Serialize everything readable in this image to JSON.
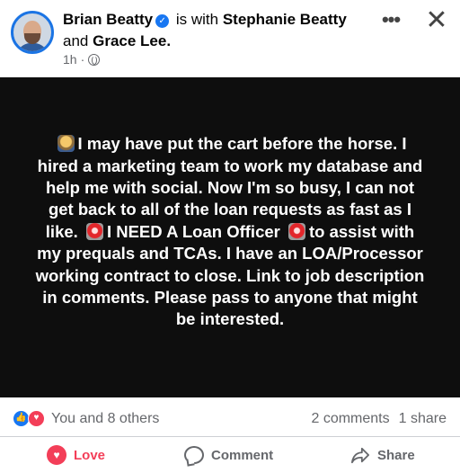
{
  "header": {
    "author": "Brian Beatty",
    "connector": "is with",
    "tagged_1": "Stephanie Beatty",
    "and_word": "and",
    "tagged_2": "Grace Lee.",
    "timestamp": "1h",
    "separator": "·",
    "privacy_icon": "globe-icon",
    "more_label": "•••",
    "close_label": "✕"
  },
  "status": {
    "background": "#0e0e0e",
    "text_color": "#ffffff",
    "part1": "I may have put the cart before the horse. I hired a marketing team to work my database and help me with social. Now I'm so busy, I can not get back to all of the loan requests as fast as I like.",
    "part2": "I NEED A Loan Officer",
    "part3": "to assist with my prequals and TCAs. I have an LOA/Processor working contract to close. Link to job description in comments. Please pass to anyone that might be interested.",
    "emoji_1": "person-shrugging",
    "emoji_2": "police-siren",
    "emoji_3": "police-siren"
  },
  "reactions": {
    "reactors": "You and 8 others",
    "comments": "2 comments",
    "shares": "1 share",
    "icons": [
      "like-icon",
      "love-icon"
    ],
    "like_color": "#1877f2",
    "love_color": "#f33e58"
  },
  "actions": {
    "love": "Love",
    "comment": "Comment",
    "share": "Share",
    "love_color": "#f33e58"
  }
}
